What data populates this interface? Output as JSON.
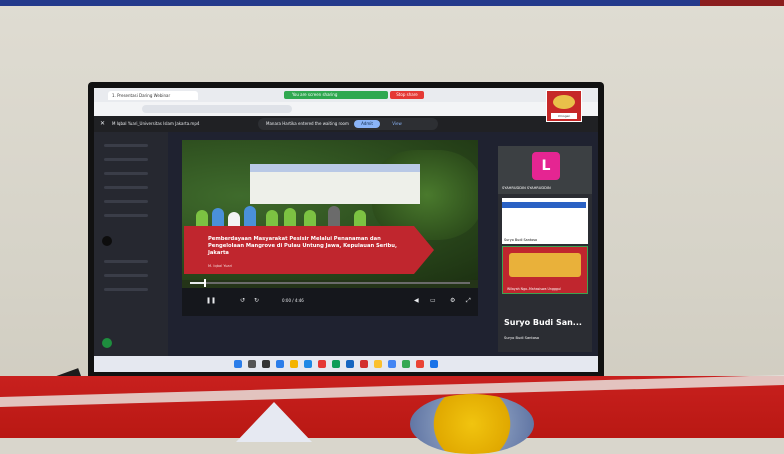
{
  "browser": {
    "tab_title": "1. Presentasi Daring Webinar",
    "sharing_text": "You are screen sharing",
    "stop_share_label": "Stop share"
  },
  "meet": {
    "file_title": "M Iqbal Yuari_Universitas Islam Jakarta.mp4",
    "notification_text": "Manara Hartika entered the waiting room",
    "admit_label": "Admit",
    "view_label": "View"
  },
  "video": {
    "overlay_title": "Pemberdayaan Masyarakat Pesisir Melalui Penanaman dan Pengelolaan Mangrove di Pulau Untung Jawa, Kepulauan Seribu, Jakarta",
    "overlay_author": "M. Iqbal Yuari",
    "time": "0:00 / 4:46",
    "progress": 0.05
  },
  "participants": {
    "avatar_letter": "L",
    "tile1_name": "SYAHRUDDIN SYAHRUDDIN",
    "tile2_name": "Suryo Budi Santoso",
    "tile3_name": "Wilayah Ngo..Mahasiswa Ungggul",
    "pinned_name_big": "Suryo Budi San...",
    "pinned_name_small": "Suryo Budi Santoso"
  },
  "thumbnail": {
    "label": "Umogen"
  },
  "colors": {
    "meet_dark": "#202124",
    "overlay_red": "#c0262e",
    "avatar_pink": "#e52592",
    "share_green": "#2fa84f",
    "banner_red": "#c8201e"
  }
}
